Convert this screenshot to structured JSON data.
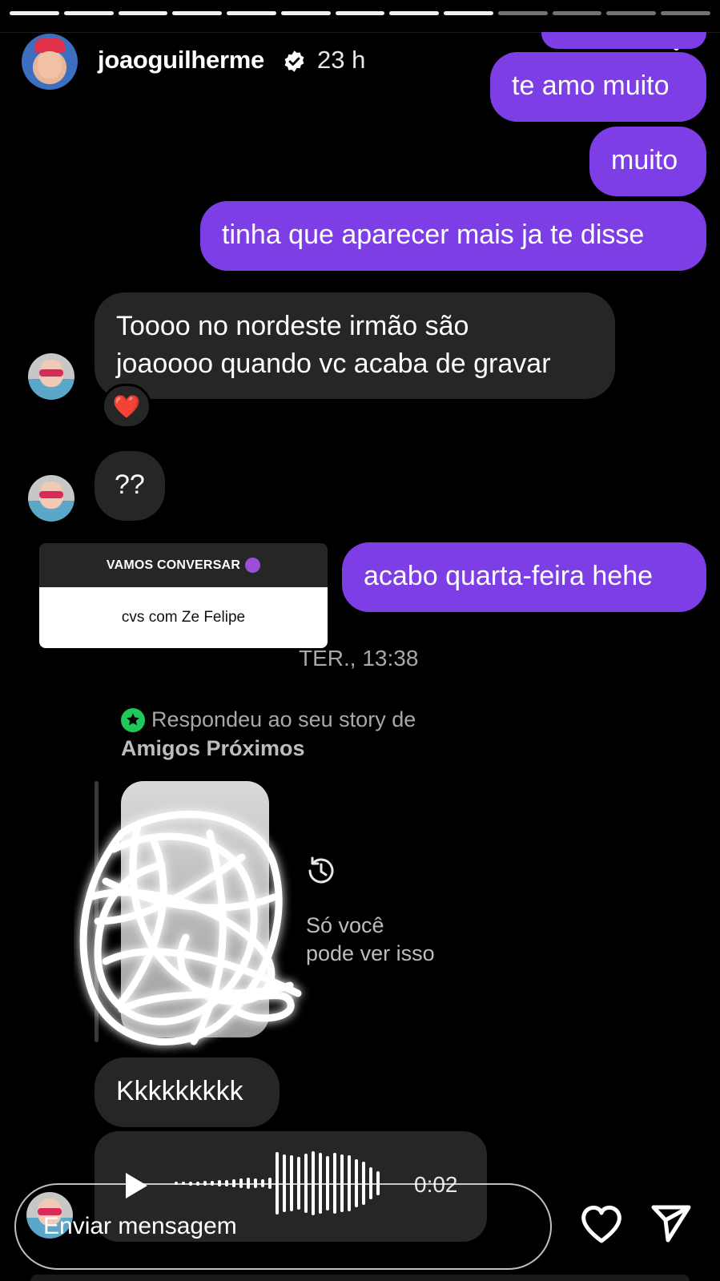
{
  "header": {
    "username": "joaoguilherme",
    "time": "23 h"
  },
  "messages": {
    "out1": "te amo muito",
    "out2": "muito",
    "out3": "tinha que aparecer mais ja te disse",
    "in1_line1": "Toooo no nordeste irmão são",
    "in1_line2": "joaoooo quando vc acaba de gravar",
    "in1_reaction": "❤️",
    "in2": "??",
    "question_title": "VAMOS CONVERSAR",
    "question_answer": "cvs com Ze Felipe",
    "out4": "acabo quarta-feira hehe",
    "timestamp": "TER., 13:38",
    "reply_note_line1": "Respondeu ao seu story de",
    "reply_note_line2": "Amigos Próximos",
    "only_you_line1": "Só você",
    "only_you_line2": "pode ver isso",
    "in3": "Kkkkkkkkk",
    "audio_duration": "0:02"
  },
  "footer": {
    "placeholder": "Enviar mensagem"
  },
  "colors": {
    "outgoing": "#7d3ee6",
    "incoming": "#262626",
    "background": "#000000"
  }
}
